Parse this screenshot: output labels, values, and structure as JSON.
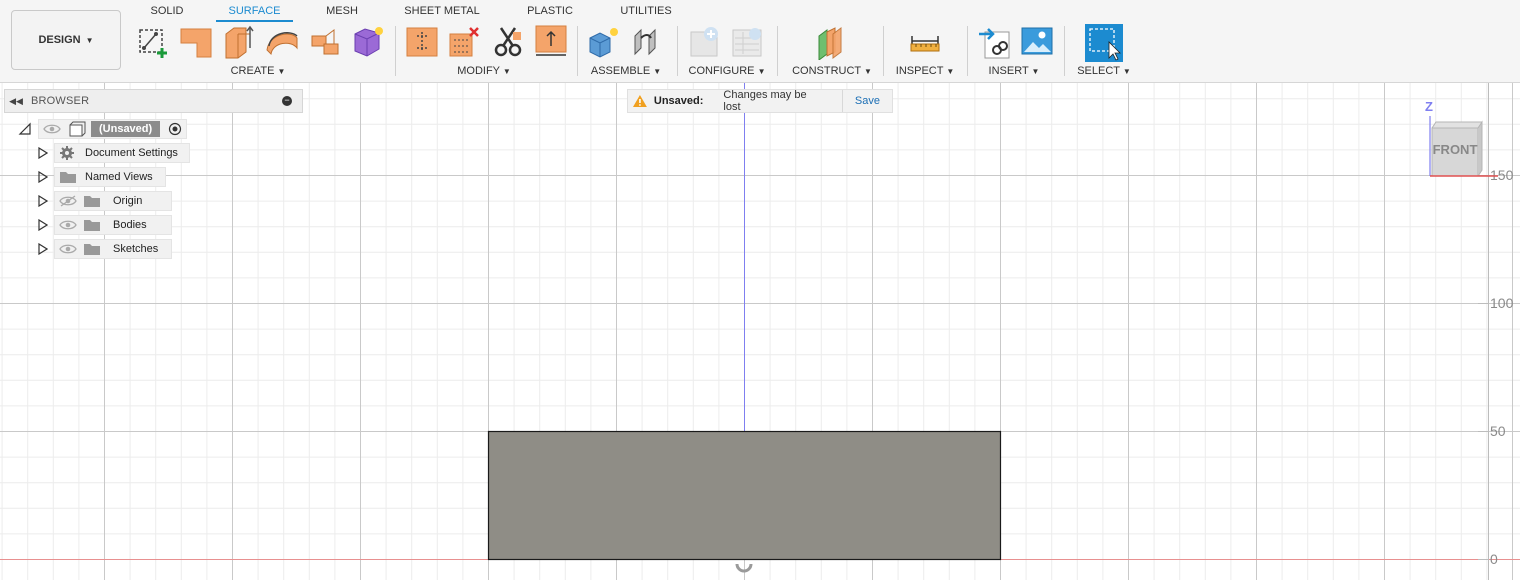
{
  "workspace": {
    "label": "DESIGN"
  },
  "tabs": [
    {
      "label": "SOLID",
      "active": false
    },
    {
      "label": "SURFACE",
      "active": true
    },
    {
      "label": "MESH",
      "active": false
    },
    {
      "label": "SHEET METAL",
      "active": false
    },
    {
      "label": "PLASTIC",
      "active": false
    },
    {
      "label": "UTILITIES",
      "active": false
    }
  ],
  "groups": {
    "create": "CREATE",
    "modify": "MODIFY",
    "assemble": "ASSEMBLE",
    "configure": "CONFIGURE",
    "construct": "CONSTRUCT",
    "inspect": "INSPECT",
    "insert": "INSERT",
    "select": "SELECT"
  },
  "browser": {
    "title": "BROWSER",
    "root": "(Unsaved)",
    "items": [
      {
        "label": "Document Settings",
        "icon": "gear-icon"
      },
      {
        "label": "Named Views",
        "icon": "folder-icon"
      },
      {
        "label": "Origin",
        "icon": "folder-icon",
        "visibility": "hidden"
      },
      {
        "label": "Bodies",
        "icon": "folder-icon",
        "visibility": "visible"
      },
      {
        "label": "Sketches",
        "icon": "folder-icon",
        "visibility": "visible"
      }
    ]
  },
  "notice": {
    "status": "Unsaved:",
    "message": "Changes may be lost",
    "action": "Save"
  },
  "viewcube": {
    "face": "FRONT",
    "axis": "Z"
  },
  "ruler": [
    "150",
    "100",
    "50",
    "0"
  ],
  "colors": {
    "accent": "#1c8bd0",
    "body_fill": "#8f8d86",
    "x_axis": "#e87070",
    "y_axis": "#6a6af0"
  }
}
